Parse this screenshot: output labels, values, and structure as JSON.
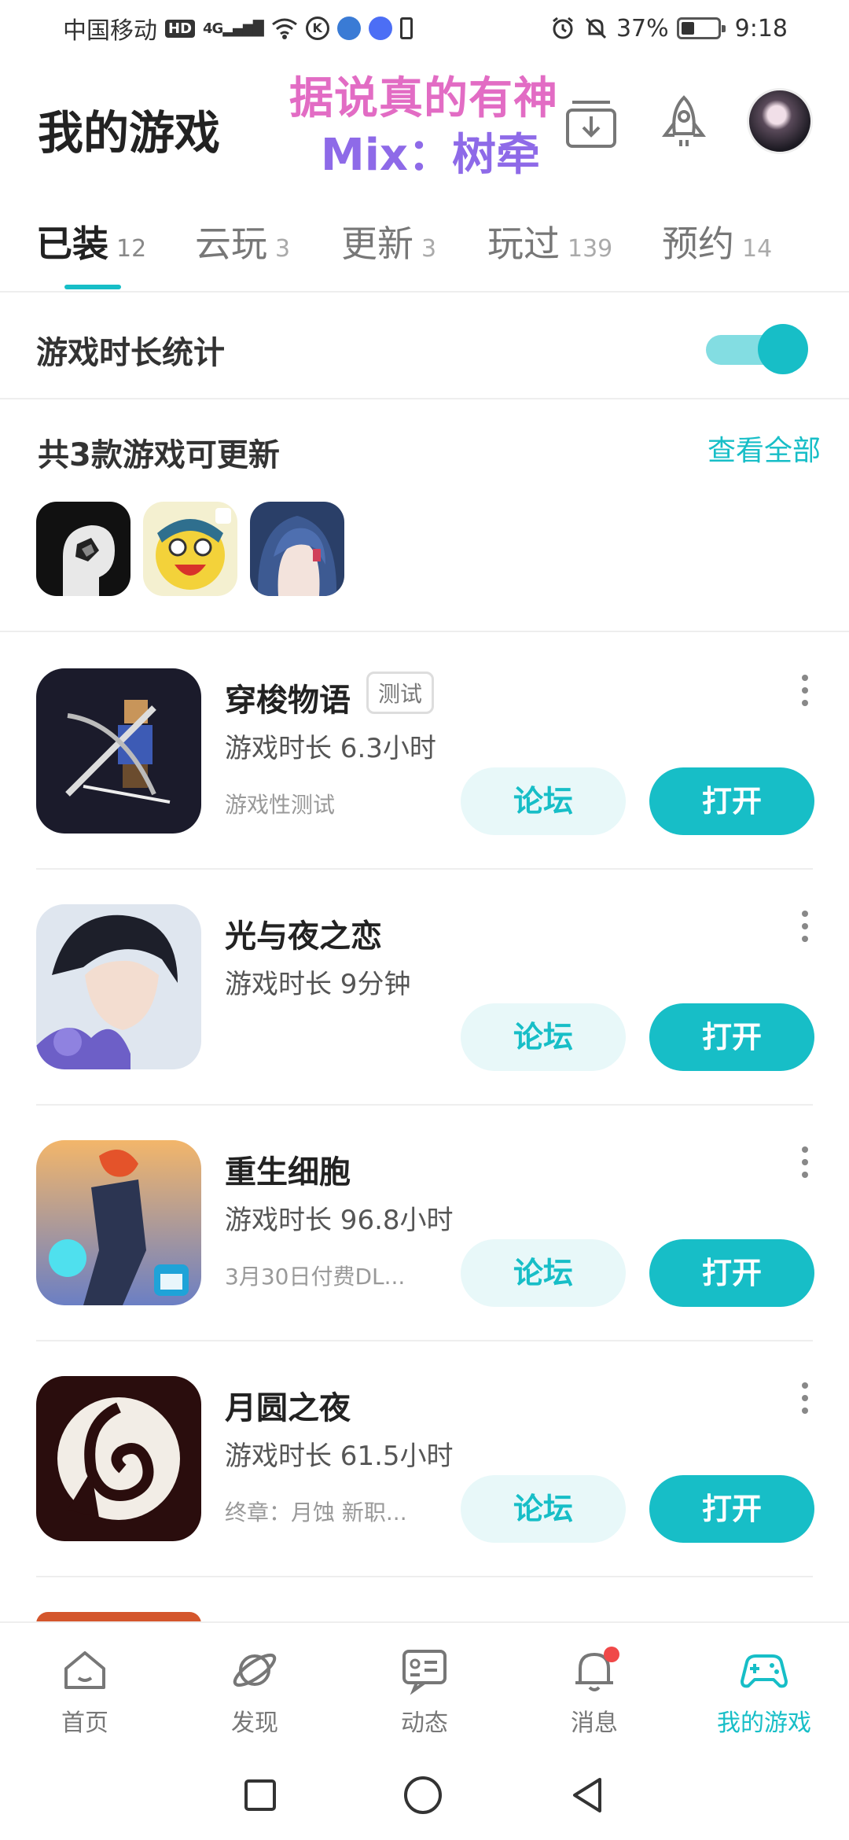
{
  "status_bar": {
    "carrier": "中国移动",
    "hd": "HD",
    "signal": "4G",
    "battery": "37%",
    "time": "9:18"
  },
  "header": {
    "title": "我的游戏",
    "watermark_line1": "据说真的有神",
    "watermark_line2": "Mix：树牵"
  },
  "tabs": [
    {
      "label": "已装",
      "count": "12",
      "active": true
    },
    {
      "label": "云玩",
      "count": "3"
    },
    {
      "label": "更新",
      "count": "3"
    },
    {
      "label": "玩过",
      "count": "139"
    },
    {
      "label": "预约",
      "count": "14"
    }
  ],
  "stats": {
    "label": "游戏时长统计",
    "enabled": true
  },
  "updates": {
    "title": "共3款游戏可更新",
    "view_all": "查看全部",
    "icons": [
      "game-icon-1",
      "game-icon-2",
      "game-icon-3"
    ]
  },
  "games": [
    {
      "name": "穿梭物语",
      "tag": "测试",
      "time": "游戏时长 6.3小时",
      "note": "游戏性测试",
      "forum": "论坛",
      "open": "打开"
    },
    {
      "name": "光与夜之恋",
      "time": "游戏时长 9分钟",
      "note": "",
      "forum": "论坛",
      "open": "打开"
    },
    {
      "name": "重生细胞",
      "time": "游戏时长 96.8小时",
      "note": "3月30日付费DL...",
      "forum": "论坛",
      "open": "打开"
    },
    {
      "name": "月圆之夜",
      "time": "游戏时长 61.5小时",
      "note": "终章：月蚀 新职...",
      "forum": "论坛",
      "open": "打开"
    }
  ],
  "bottom_nav": [
    {
      "label": "首页",
      "icon": "home-icon"
    },
    {
      "label": "发现",
      "icon": "planet-icon"
    },
    {
      "label": "动态",
      "icon": "feed-icon"
    },
    {
      "label": "消息",
      "icon": "bell-icon",
      "badge": true
    },
    {
      "label": "我的游戏",
      "icon": "gamepad-icon",
      "active": true
    }
  ],
  "colors": {
    "accent": "#17bec7",
    "accent_light": "#e8f8f9",
    "badge_red": "#f04848",
    "watermark_pink": "#e26cc4",
    "watermark_purple": "#8e6ae8"
  }
}
